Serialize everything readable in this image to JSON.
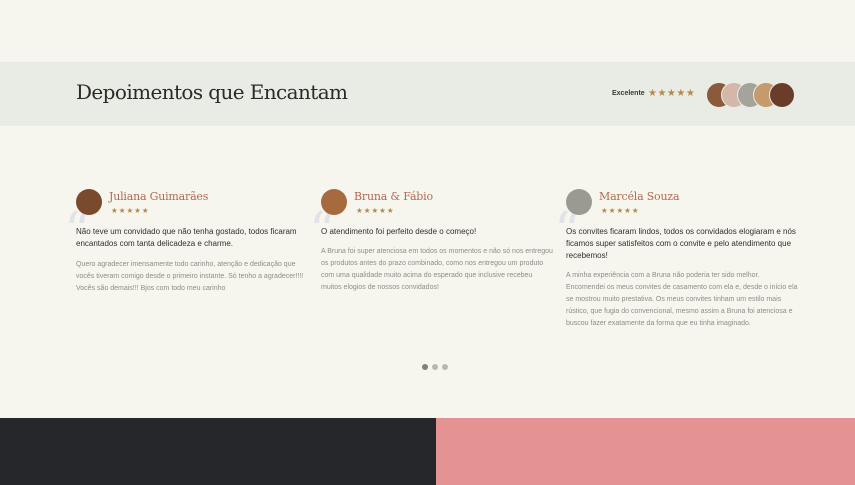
{
  "header": {
    "title": "Depoimentos que Encantam",
    "rating_label": "Excelente",
    "rating_stars": "★★★★★"
  },
  "header_avatars": [
    {
      "icon": "client-photo-1",
      "color": "#8a5a3a"
    },
    {
      "icon": "client-photo-2",
      "color": "#d3b7a8"
    },
    {
      "icon": "client-photo-3",
      "color": "#a4a39c"
    },
    {
      "icon": "client-photo-4",
      "color": "#c69a6c"
    },
    {
      "icon": "client-photo-5",
      "color": "#6a3d2a"
    }
  ],
  "testimonials": [
    {
      "name": "Juliana Guimarães",
      "stars": "★★★★★",
      "headline": "Não teve um convidado que não tenha gostado, todos ficaram encantados com tanta delicadeza e charme.",
      "body": "Quero agradecer imensamente todo carinho, atenção e dedicação que vocês tiveram comigo desde o primeiro instante. Só tenho a agradecer!!!! Vocês são demais!!! Bjos com todo meu carinho",
      "avatar_color": "#7a4a2c"
    },
    {
      "name": "Bruna & Fábio",
      "stars": "★★★★★",
      "headline": "O atendimento foi perfeito desde o começo!",
      "body": "A Bruna foi super atenciosa em todos os momentos e não só nos entregou os produtos antes do prazo combinado, como nos entregou um produto com uma qualidade muito acima do esperado que inclusive recebeu muitos elogios de nossos convidados!",
      "avatar_color": "#a66a3e"
    },
    {
      "name": "Marcéla Souza",
      "stars": "★★★★★",
      "headline": "Os convites ficaram lindos, todos os convidados elogiaram e nós ficamos super satisfeitos com o convite e pelo atendimento que recebemos!",
      "body": "A minha experiência com a Bruna não poderia ter sido melhor. Encomendei os meus convites de casamento com ela e, desde o início ela se mostrou muito prestativa. Os meus convites tinham um estilo mais rústico, que fugia do convencional, mesmo assim a Bruna foi atenciosa e buscou fazer exatamente da forma que eu tinha imaginado.",
      "avatar_color": "#9a9a92"
    }
  ],
  "pagination": {
    "total": 3,
    "active": 1
  },
  "colors": {
    "page_bg": "#f7f6ee",
    "banner_bg": "#e9ebe5",
    "accent_name": "#b06a52",
    "star": "#b38a50",
    "footer_dark": "#25272b",
    "footer_pink": "#e49392"
  }
}
